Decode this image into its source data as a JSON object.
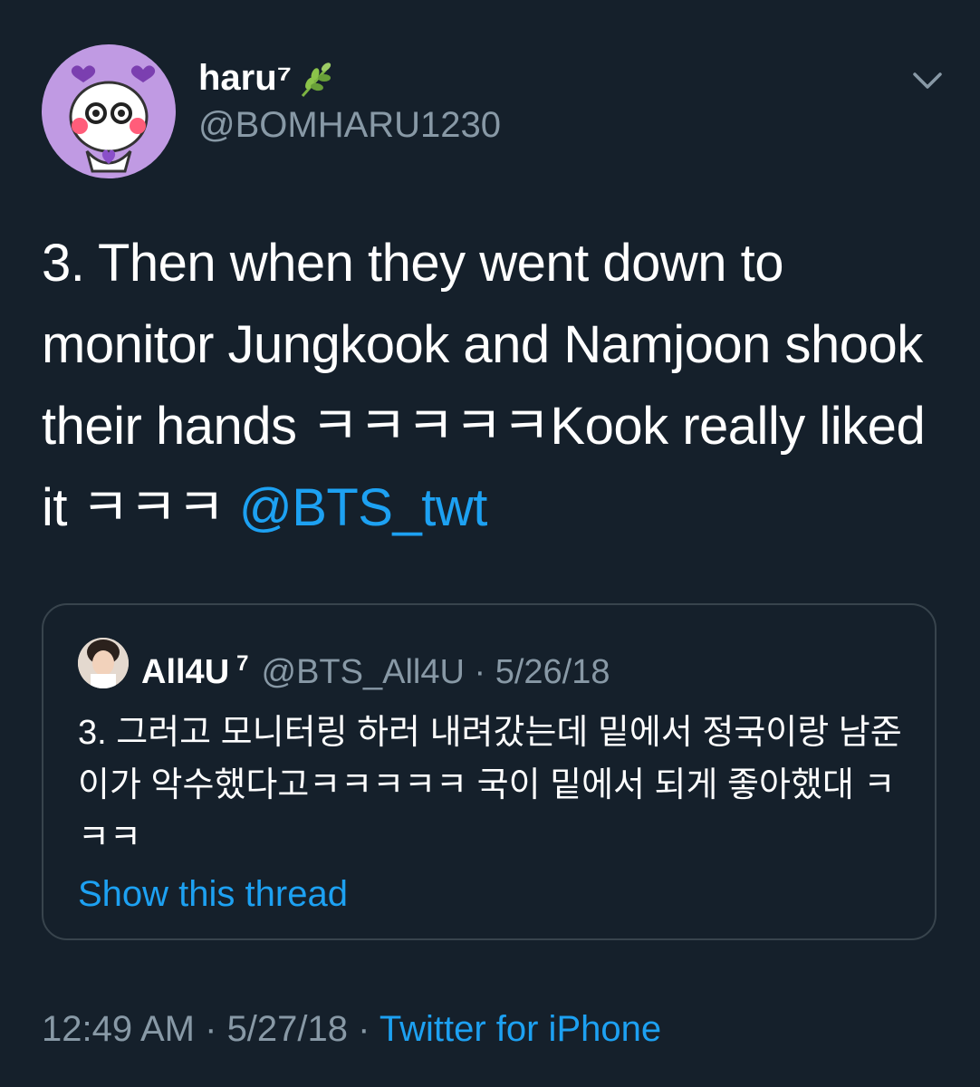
{
  "tweet": {
    "author": {
      "display_name": "haru⁷",
      "emoji": "herb-emoji",
      "handle": "@BOMHARU1230",
      "avatar": "purple-cartoon-avatar"
    },
    "menu_icon": "chevron-down-icon",
    "text_parts": [
      "3. Then when they went down to monitor Jungkook and Namjoon shook their hands ㅋㅋㅋㅋㅋKook really liked it  ㅋㅋㅋ ",
      "@BTS_twt"
    ],
    "timestamp": "12:49 AM",
    "date": "5/27/18",
    "source": "Twitter for iPhone",
    "separator": " · "
  },
  "quote": {
    "name": "All4U",
    "name_sup": "7",
    "handle": "@BTS_All4U",
    "separator": " · ",
    "date": "5/26/18",
    "body": "3. 그러고 모니터링 하러 내려갔는데 밑에서 정국이랑 남준이가 악수했다고ㅋㅋㅋㅋㅋ 국이 밑에서 되게 좋아했대 ㅋㅋㅋ",
    "show_thread": "Show this thread"
  },
  "colors": {
    "background": "#15202b",
    "accent": "#1da1f2",
    "secondary_text": "#8899a6",
    "border": "#38444d"
  }
}
